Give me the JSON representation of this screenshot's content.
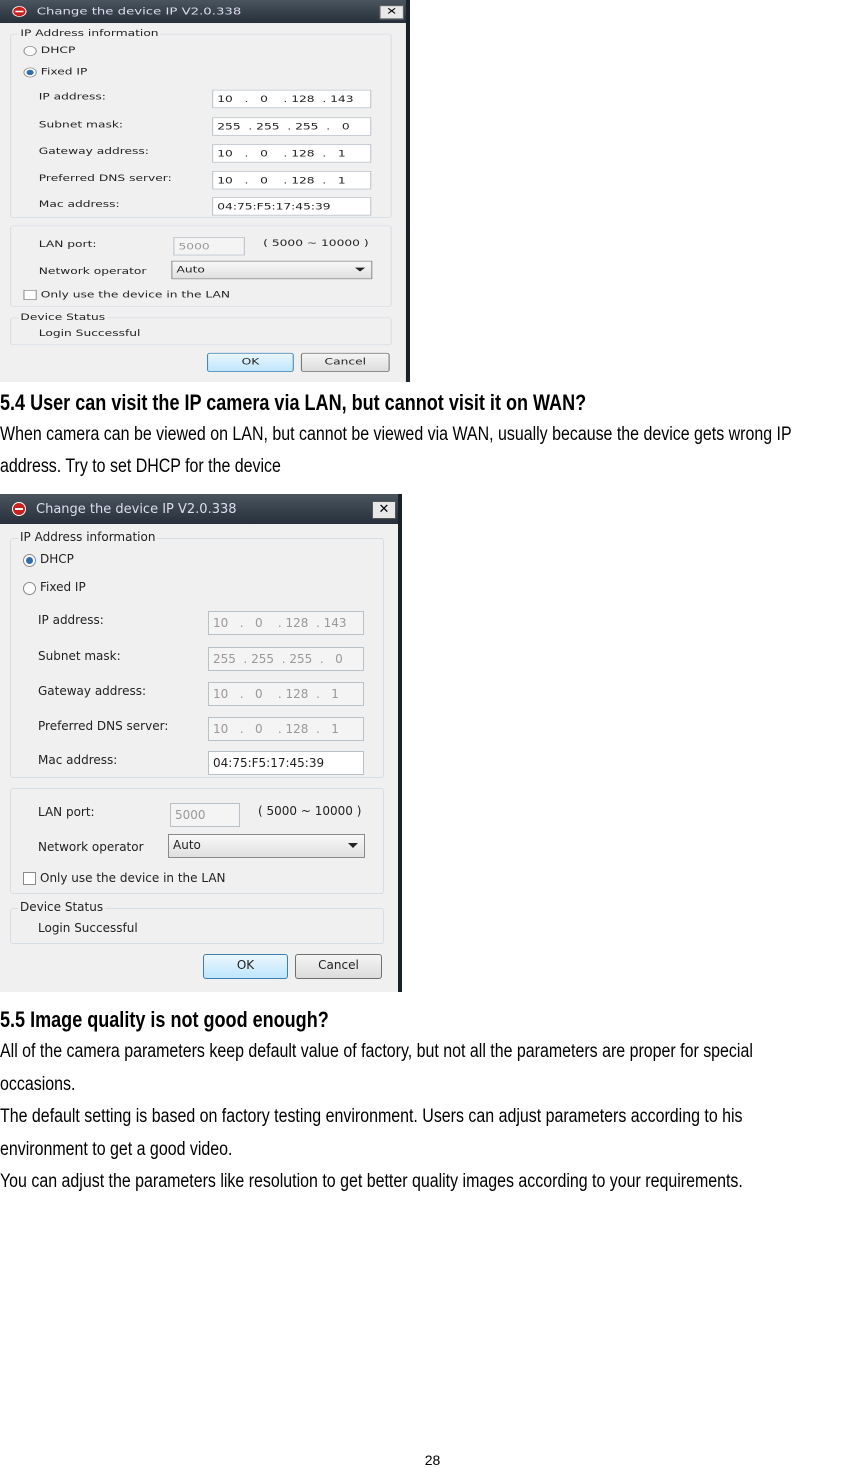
{
  "dialogs": [
    {
      "title": "Change the device IP   V2.0.338",
      "close": "✕",
      "group_ip": "IP Address information",
      "dhcp": "DHCP",
      "fixed_ip": "Fixed IP",
      "mode": "fixed",
      "fields": [
        {
          "label": "IP address:",
          "value": "10   .   0    . 128  . 143"
        },
        {
          "label": "Subnet mask:",
          "value": "255  . 255  . 255  .   0"
        },
        {
          "label": "Gateway address:",
          "value": "10   .   0    . 128  .   1"
        },
        {
          "label": "Preferred DNS server:",
          "value": "10   .   0    . 128  .   1"
        },
        {
          "label": "Mac address:",
          "value": "04:75:F5:17:45:39"
        }
      ],
      "lan_port_label": "LAN port:",
      "lan_port_value": "5000",
      "lan_port_range": "( 5000 ~ 10000 )",
      "network_operator_label": "Network operator",
      "network_operator_value": "Auto",
      "lan_only_label": "Only use the device in the LAN",
      "device_status_label": "Device Status",
      "device_status_value": "Login Successful",
      "ok": "OK",
      "cancel": "Cancel"
    },
    {
      "title": "Change the device IP   V2.0.338",
      "close": "✕",
      "group_ip": "IP Address information",
      "dhcp": "DHCP",
      "fixed_ip": "Fixed IP",
      "mode": "dhcp",
      "fields": [
        {
          "label": "IP address:",
          "value": "10   .   0    . 128  . 143"
        },
        {
          "label": "Subnet mask:",
          "value": "255  . 255  . 255  .   0"
        },
        {
          "label": "Gateway address:",
          "value": "10   .   0    . 128  .   1"
        },
        {
          "label": "Preferred DNS server:",
          "value": "10   .   0    . 128  .   1"
        },
        {
          "label": "Mac address:",
          "value": "04:75:F5:17:45:39"
        }
      ],
      "lan_port_label": "LAN port:",
      "lan_port_value": "5000",
      "lan_port_range": "( 5000 ~ 10000 )",
      "network_operator_label": "Network operator",
      "network_operator_value": "Auto",
      "lan_only_label": "Only use the device in the LAN",
      "device_status_label": "Device Status",
      "device_status_value": "Login Successful",
      "ok": "OK",
      "cancel": "Cancel"
    }
  ],
  "section_5_4": {
    "heading": "5.4 User can visit the IP camera via LAN, but cannot visit it on WAN?",
    "lines": [
      "When camera can be viewed on LAN, but cannot be viewed via WAN, usually because the device gets wrong IP",
      "address. Try to set DHCP for the device"
    ]
  },
  "section_5_5": {
    "heading": "5.5 Image quality is not good enough?",
    "lines": [
      "All of the camera parameters keep default value of factory, but not all the parameters are proper for special",
      "occasions.",
      "The default setting is based on factory testing environment. Users can adjust parameters according to his",
      "environment to get a good video.",
      "You can adjust the parameters like resolution to get better quality images according to your requirements."
    ]
  },
  "page_number": "28"
}
